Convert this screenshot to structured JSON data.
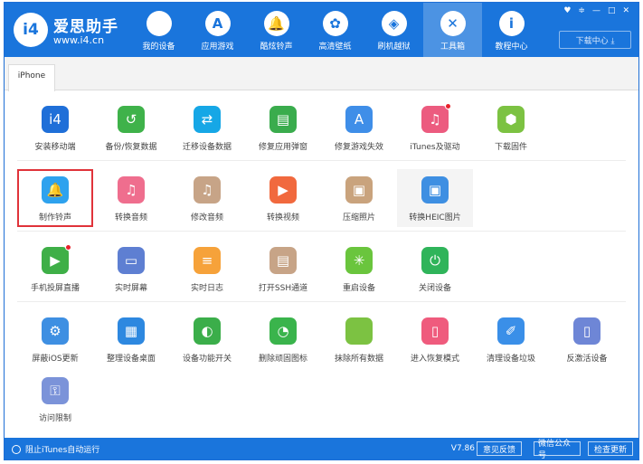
{
  "app": {
    "logo_text": "i4",
    "title": "爱思助手",
    "url": "www.i4.cn",
    "download_center": "下载中心 ⤓"
  },
  "nav": [
    {
      "label": "我的设备",
      "icon": "apple-icon",
      "glyph": ""
    },
    {
      "label": "应用游戏",
      "icon": "app-store-icon",
      "glyph": "A"
    },
    {
      "label": "酷炫铃声",
      "icon": "bell-icon",
      "glyph": "🔔"
    },
    {
      "label": "高清壁纸",
      "icon": "flower-icon",
      "glyph": "✿"
    },
    {
      "label": "刷机越狱",
      "icon": "box-icon",
      "glyph": "◈"
    },
    {
      "label": "工具箱",
      "icon": "tools-icon",
      "glyph": "✕"
    },
    {
      "label": "教程中心",
      "icon": "info-icon",
      "glyph": "i"
    }
  ],
  "window_controls": [
    "♥",
    "≑",
    "—",
    "□",
    "✕"
  ],
  "device_tab": "iPhone",
  "tools": {
    "row1": [
      {
        "label": "安装移动端",
        "icon": "i4-app-icon",
        "color": "#1f6fd8",
        "glyph": "i4",
        "dot": false
      },
      {
        "label": "备份/恢复数据",
        "icon": "backup-icon",
        "color": "#3fb24a",
        "glyph": "↺",
        "dot": false
      },
      {
        "label": "迁移设备数据",
        "icon": "migrate-icon",
        "color": "#16a7e6",
        "glyph": "⇄",
        "dot": false
      },
      {
        "label": "修复应用弹窗",
        "icon": "appleid-icon",
        "color": "#3aac4d",
        "glyph": "▤",
        "dot": false
      },
      {
        "label": "修复游戏失效",
        "icon": "appstore-fix-icon",
        "color": "#3f8ee8",
        "glyph": "A",
        "dot": false
      },
      {
        "label": "iTunes及驱动",
        "icon": "itunes-icon",
        "color": "#ec5b7f",
        "glyph": "♫",
        "dot": true
      },
      {
        "label": "下载固件",
        "icon": "firmware-icon",
        "color": "#7cc242",
        "glyph": "⬢",
        "dot": false
      }
    ],
    "row2": [
      {
        "label": "制作铃声",
        "icon": "ringtone-bell-icon",
        "color": "#2ea2ee",
        "glyph": "🔔",
        "dot": false
      },
      {
        "label": "转换音频",
        "icon": "convert-audio-icon",
        "color": "#ef6e8e",
        "glyph": "♫",
        "dot": false
      },
      {
        "label": "修改音频",
        "icon": "edit-audio-icon",
        "color": "#c7a487",
        "glyph": "♫",
        "dot": false
      },
      {
        "label": "转换视频",
        "icon": "convert-video-icon",
        "color": "#f1693e",
        "glyph": "▶",
        "dot": false
      },
      {
        "label": "压缩照片",
        "icon": "compress-photo-icon",
        "color": "#c9a37d",
        "glyph": "▣",
        "dot": false
      },
      {
        "label": "转换HEIC图片",
        "icon": "heic-icon",
        "color": "#3e8fe2",
        "glyph": "▣",
        "dot": false
      }
    ],
    "row3": [
      {
        "label": "手机投屏直播",
        "icon": "screen-cast-icon",
        "color": "#3eaf47",
        "glyph": "▶",
        "dot": true
      },
      {
        "label": "实时屏幕",
        "icon": "monitor-icon",
        "color": "#5e7fd2",
        "glyph": "▭",
        "dot": false
      },
      {
        "label": "实时日志",
        "icon": "log-icon",
        "color": "#f6a23a",
        "glyph": "≡",
        "dot": false
      },
      {
        "label": "打开SSH通道",
        "icon": "ssh-icon",
        "color": "#c7a487",
        "glyph": "▤",
        "dot": false
      },
      {
        "label": "重启设备",
        "icon": "restart-icon",
        "color": "#6ac53d",
        "glyph": "✳",
        "dot": false
      },
      {
        "label": "关闭设备",
        "icon": "power-icon",
        "color": "#2fb45a",
        "glyph": "⏻",
        "dot": false
      }
    ],
    "row4": [
      {
        "label": "屏蔽iOS更新",
        "icon": "block-update-icon",
        "color": "#3e8fe2",
        "glyph": "⚙",
        "dot": false
      },
      {
        "label": "整理设备桌面",
        "icon": "desktop-grid-icon",
        "color": "#2d88e0",
        "glyph": "▦",
        "dot": false
      },
      {
        "label": "设备功能开关",
        "icon": "toggle-icon",
        "color": "#3bae4a",
        "glyph": "◐",
        "dot": false
      },
      {
        "label": "删除顽固图标",
        "icon": "delete-icon-icon",
        "color": "#3ab44c",
        "glyph": "◔",
        "dot": false
      },
      {
        "label": "抹除所有数据",
        "icon": "erase-icon",
        "color": "#7cc242",
        "glyph": "",
        "dot": false
      },
      {
        "label": "进入恢复模式",
        "icon": "recovery-icon",
        "color": "#ef5b7d",
        "glyph": "▯",
        "dot": false
      },
      {
        "label": "清理设备垃圾",
        "icon": "broom-icon",
        "color": "#3a8fe8",
        "glyph": "✐",
        "dot": false
      },
      {
        "label": "反激活设备",
        "icon": "deactivate-icon",
        "color": "#6e86d6",
        "glyph": "▯",
        "dot": false
      }
    ],
    "row5": [
      {
        "label": "访问限制",
        "icon": "restriction-icon",
        "color": "#7b93d9",
        "glyph": "⚿",
        "dot": false
      }
    ]
  },
  "status": {
    "itunes_toggle": "阻止iTunes自动运行",
    "version": "V7.86",
    "buttons": [
      "意见反馈",
      "微信公众号",
      "检查更新"
    ]
  }
}
